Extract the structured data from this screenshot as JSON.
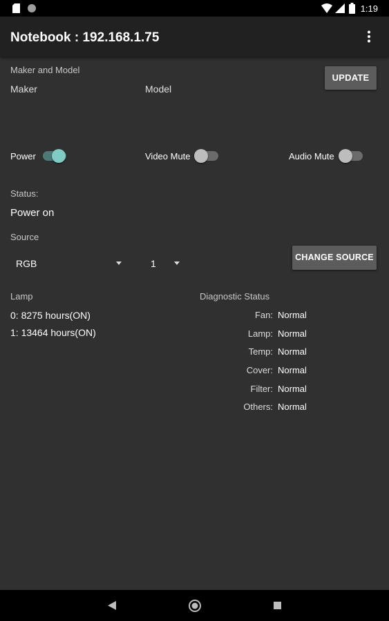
{
  "statusbar": {
    "time": "1:19"
  },
  "toolbar": {
    "title": "Notebook : 192.168.1.75"
  },
  "maker_model": {
    "section_label": "Maker and Model",
    "maker_label": "Maker",
    "model_label": "Model",
    "update_button": "UPDATE"
  },
  "toggles": {
    "power": {
      "label": "Power",
      "on": true
    },
    "video_mute": {
      "label": "Video Mute",
      "on": false
    },
    "audio_mute": {
      "label": "Audio Mute",
      "on": false
    }
  },
  "status": {
    "label": "Status:",
    "value": "Power on"
  },
  "source": {
    "label": "Source",
    "type_selected": "RGB",
    "number_selected": "1",
    "change_button": "CHANGE SOURCE"
  },
  "lamp": {
    "label": "Lamp",
    "entries": [
      "0: 8275 hours(ON)",
      "1: 13464 hours(ON)"
    ]
  },
  "diagnostic": {
    "label": "Diagnostic Status",
    "items": [
      {
        "name": "Fan:",
        "value": "Normal"
      },
      {
        "name": "Lamp:",
        "value": "Normal"
      },
      {
        "name": "Temp:",
        "value": "Normal"
      },
      {
        "name": "Cover:",
        "value": "Normal"
      },
      {
        "name": "Filter:",
        "value": "Normal"
      },
      {
        "name": "Others:",
        "value": "Normal"
      }
    ]
  },
  "colors": {
    "accent": "#80cbc4",
    "background": "#303030",
    "toolbar": "#212121",
    "button": "#5c5c5c"
  },
  "icons": [
    "sim-card-icon",
    "notification-dot-icon",
    "wifi-icon",
    "signal-icon",
    "battery-icon",
    "overflow-menu-icon",
    "back-icon",
    "home-icon",
    "recents-icon"
  ]
}
